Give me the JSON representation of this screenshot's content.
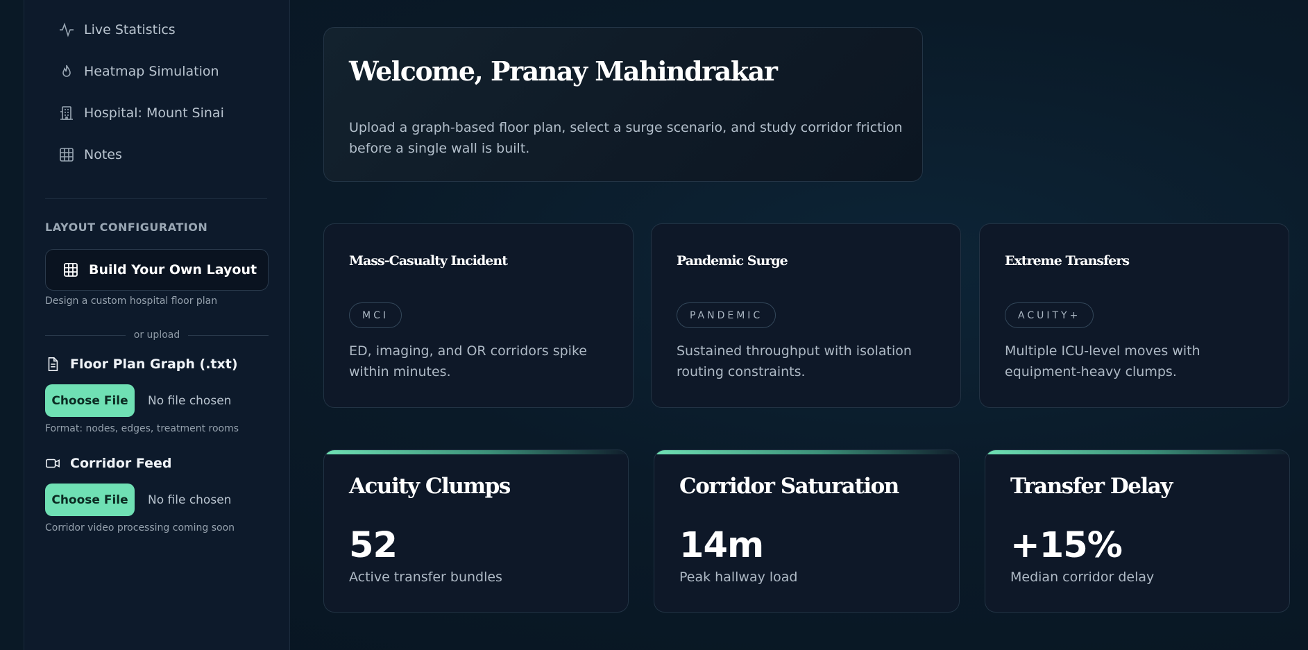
{
  "sidebar": {
    "nav": [
      {
        "label": "Live Statistics",
        "icon": "activity-icon"
      },
      {
        "label": "Heatmap Simulation",
        "icon": "flame-icon"
      },
      {
        "label": "Hospital: Mount Sinai",
        "icon": "building-icon"
      },
      {
        "label": "Notes",
        "icon": "grid-icon"
      }
    ],
    "layout_config_title": "LAYOUT CONFIGURATION",
    "build_button": "Build Your Own Layout",
    "build_note": "Design a custom hospital floor plan",
    "or_upload": "or upload",
    "floor_plan": {
      "title": "Floor Plan Graph (.txt)",
      "choose": "Choose File",
      "status": "No file chosen",
      "note": "Format: nodes, edges, treatment rooms"
    },
    "corridor_feed": {
      "title": "Corridor Feed",
      "choose": "Choose File",
      "status": "No file chosen",
      "note": "Corridor video processing coming soon"
    }
  },
  "welcome": {
    "title": "Welcome, Pranay Mahindrakar",
    "description": "Upload a graph-based floor plan, select a surge scenario, and study corridor friction before a single wall is built."
  },
  "scenarios": [
    {
      "title": "Mass-Casualty Incident",
      "tag": "MCI",
      "description": "ED, imaging, and OR corridors spike within minutes."
    },
    {
      "title": "Pandemic Surge",
      "tag": "PANDEMIC",
      "description": "Sustained throughput with isolation routing constraints."
    },
    {
      "title": "Extreme Transfers",
      "tag": "ACUITY+",
      "description": "Multiple ICU-level moves with equipment-heavy clumps."
    }
  ],
  "metrics": [
    {
      "title": "Acuity Clumps",
      "value": "52",
      "caption": "Active transfer bundles"
    },
    {
      "title": "Corridor Saturation",
      "value": "14m",
      "caption": "Peak hallway load"
    },
    {
      "title": "Transfer Delay",
      "value": "+15%",
      "caption": "Median corridor delay"
    }
  ],
  "colors": {
    "accent": "#6fe0b4",
    "background": "#0a1a28",
    "panel": "#0e1828"
  }
}
